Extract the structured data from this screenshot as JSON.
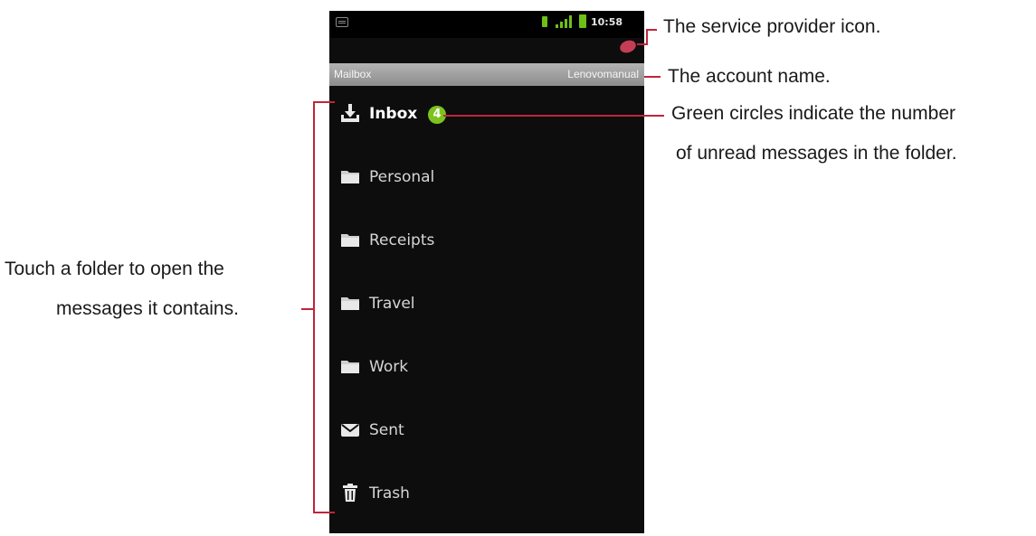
{
  "status_bar": {
    "time": "10:58"
  },
  "header": {
    "title": "Mailbox",
    "account": "Lenovomanual"
  },
  "folders": [
    {
      "label": "Inbox",
      "icon": "inbox-download-icon",
      "unread": "4",
      "bold": true
    },
    {
      "label": "Personal",
      "icon": "folder-icon"
    },
    {
      "label": "Receipts",
      "icon": "folder-icon"
    },
    {
      "label": "Travel",
      "icon": "folder-icon"
    },
    {
      "label": "Work",
      "icon": "folder-icon"
    },
    {
      "label": "Sent",
      "icon": "envelope-icon"
    },
    {
      "label": "Trash",
      "icon": "trash-icon"
    }
  ],
  "callouts": {
    "provider": "The service provider icon.",
    "account": "The account name.",
    "unread_line1": "Green circles indicate the number",
    "unread_line2": "of unread messages in the folder.",
    "folders_line1": "Touch a folder to open the",
    "folders_line2": "messages it contains."
  },
  "colors": {
    "leader": "#c0243c",
    "badge": "#7cc31e",
    "screen_bg": "#0d0d0d"
  }
}
